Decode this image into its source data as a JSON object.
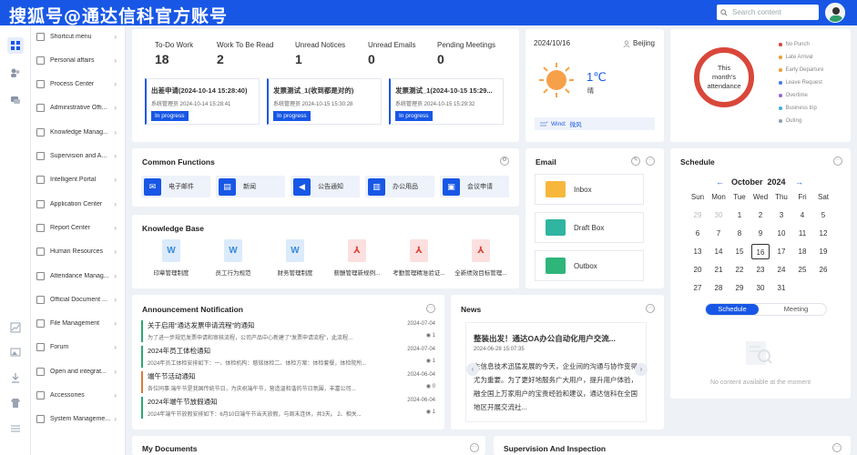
{
  "header": {
    "brand": "搜狐号@通达信科官方账号",
    "search_placeholder": "Search content"
  },
  "colors": {
    "primary": "#1857e6",
    "green": "#2aa876",
    "ring": "#d9473a"
  },
  "menu": [
    {
      "label": "Shortcut menu"
    },
    {
      "label": "Personal affairs"
    },
    {
      "label": "Process Center"
    },
    {
      "label": "Administrative Offi..."
    },
    {
      "label": "Knowledge Manag..."
    },
    {
      "label": "Supervision and A..."
    },
    {
      "label": "Intelligent Portal"
    },
    {
      "label": "Application Center"
    },
    {
      "label": "Report Center"
    },
    {
      "label": "Human Resources"
    },
    {
      "label": "Attendance Manag..."
    },
    {
      "label": "Official Document ..."
    },
    {
      "label": "File Management"
    },
    {
      "label": "Forum"
    },
    {
      "label": "Open and integrat..."
    },
    {
      "label": "Accessories"
    },
    {
      "label": "System Manageme..."
    }
  ],
  "stats": [
    {
      "label": "To-Do Work",
      "value": "18"
    },
    {
      "label": "Work To Be Read",
      "value": "2"
    },
    {
      "label": "Unread Notices",
      "value": "1"
    },
    {
      "label": "Unread Emails",
      "value": "0"
    },
    {
      "label": "Pending Meetings",
      "value": "0"
    }
  ],
  "tasks": [
    {
      "title": "出差申请(2024-10-14 15:28:40)",
      "meta": "系统管理员    2024-10-14 15:28:41",
      "status": "In progress"
    },
    {
      "title": "发票测试_1(收到都是对的)",
      "meta": "系统管理员    2024-10-15 15:30:28",
      "status": "In progress"
    },
    {
      "title": "发票测试_1(2024-10-15 15:29...",
      "meta": "系统管理员    2024-10-15 15:29:32",
      "status": "In progress"
    }
  ],
  "weather": {
    "date": "2024/10/16",
    "city": "Beijing",
    "temp": "1℃",
    "desc": "晴",
    "wind_label": "Wind:",
    "wind": "微风"
  },
  "attendance": {
    "label": "This month's attendance",
    "legend": [
      "No Punch",
      "Late Arrival",
      "Early Departure",
      "Leave Request",
      "Overtime",
      "Business trip",
      "Outing"
    ]
  },
  "common": {
    "title": "Common Functions",
    "items": [
      "电子邮件",
      "新闻",
      "公告通知",
      "办公用品",
      "会议申请"
    ]
  },
  "email": {
    "title": "Email",
    "folders": [
      "Inbox",
      "Draft Box",
      "Outbox"
    ]
  },
  "schedule": {
    "title": "Schedule",
    "month": "October",
    "year": "2024",
    "prev": "←",
    "next": "→",
    "weekdays": [
      "Sun",
      "Mon",
      "Tue",
      "Wed",
      "Thu",
      "Fri",
      "Sat"
    ],
    "days": [
      "29",
      "30",
      "1",
      "2",
      "3",
      "4",
      "5",
      "6",
      "7",
      "8",
      "9",
      "10",
      "11",
      "12",
      "13",
      "14",
      "15",
      "16",
      "17",
      "18",
      "19",
      "20",
      "21",
      "22",
      "23",
      "24",
      "25",
      "26",
      "27",
      "28",
      "29",
      "30",
      "31"
    ],
    "today": "16",
    "tab_schedule": "Schedule",
    "tab_meeting": "Meeting",
    "empty": "No content available at the moment"
  },
  "knowledge": {
    "title": "Knowledge Base",
    "items": [
      "印章管理制度",
      "员工行为规范",
      "财务管理制度",
      "薪酬管理新规例...",
      "考勤管理精准验证...",
      "全新绩效目标管理..."
    ]
  },
  "announcements": {
    "title": "Announcement Notification",
    "items": [
      {
        "title": "关于启用“通达发票申请流程”的通知",
        "summary": "为了进一步规范发票申请和审核流程，公司产品中心新建了“发票申请流程”，此流程...",
        "date": "2024-07-04",
        "views": "1"
      },
      {
        "title": "2024年员工体检通知",
        "summary": "2024年员工体检安排如下：一、体检机构：慈铭体检二、体检方案：体检套餐，体检院所...",
        "date": "2024-07-04",
        "views": "1"
      },
      {
        "title": "端午节活动通知",
        "summary": "各位同事:端午节是我国传统节日，为庆祝端午节，营造温和谐的节日氛围，丰富公司...",
        "date": "2024-06-04",
        "views": "0"
      },
      {
        "title": "2024年端午节放假通知",
        "summary": "2024年端午节放假安排如下：6月10日端午节当天放假，与周末连休，共3天。 2、相关...",
        "date": "2024-06-04",
        "views": "1"
      }
    ]
  },
  "news": {
    "title": "News",
    "headline": "整装出发！通达OA办公自动化用户交流...",
    "date": "2024-06-28 15:07:35",
    "body": "在信息技术迅猛发展的今天，企业间的沟通与协作变得尤为重要。为了更好地服务广大用户，提升用户体验，融全国上万家用户的宝贵经验和建议，通达信科在全国地区开展交流社..."
  },
  "bottom": {
    "my_documents": "My Documents",
    "supervision": "Supervision And Inspection"
  }
}
